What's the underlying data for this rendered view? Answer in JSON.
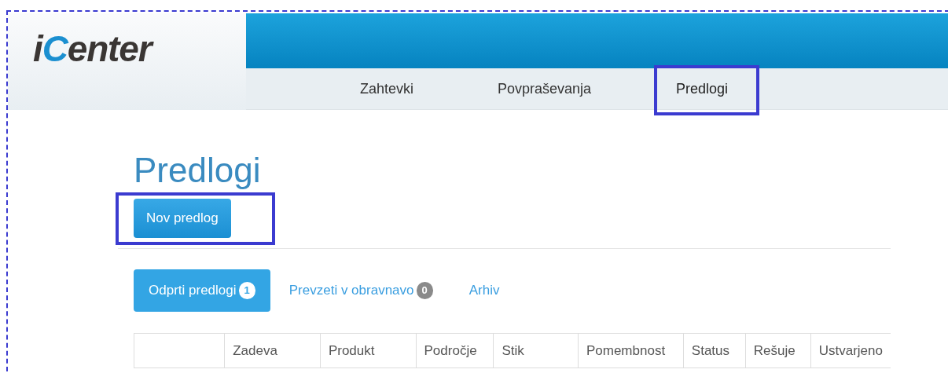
{
  "logo": {
    "text": "iCenter"
  },
  "nav": [
    {
      "label": "Zahtevki",
      "selected": false,
      "highlighted": false
    },
    {
      "label": "Povpraševanja",
      "selected": false,
      "highlighted": false
    },
    {
      "label": "Predlogi",
      "selected": true,
      "highlighted": true
    }
  ],
  "page_title": "Predlogi",
  "new_button": {
    "label": "Nov predlog",
    "highlighted": true
  },
  "tabs": [
    {
      "label": "Odprti predlogi",
      "count": "1",
      "selected": true
    },
    {
      "label": "Prevzeti v obravnavo",
      "count": "0",
      "selected": false
    },
    {
      "label": "Arhiv",
      "selected": false
    }
  ],
  "table": {
    "columns": [
      "",
      "Zadeva",
      "Produkt",
      "Področje",
      "Stik",
      "Pomembnost",
      "Status",
      "Rešuje",
      "Ustvarjeno"
    ]
  }
}
